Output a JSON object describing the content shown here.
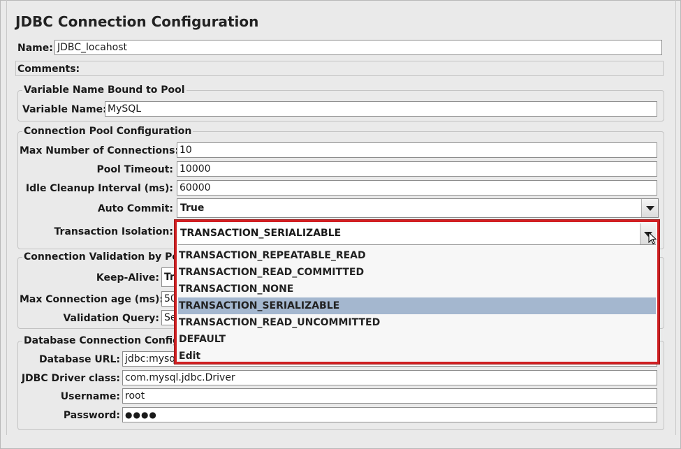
{
  "title": "JDBC Connection Configuration",
  "name": {
    "label": "Name:",
    "value": "JDBC_locahost"
  },
  "comments": {
    "label": "Comments:",
    "value": ""
  },
  "variable_group": {
    "legend": "Variable Name Bound to Pool",
    "variable_name": {
      "label": "Variable Name:",
      "value": "MySQL"
    }
  },
  "pool_group": {
    "legend": "Connection Pool Configuration",
    "max_connections": {
      "label": "Max Number of Connections:",
      "value": "10"
    },
    "pool_timeout": {
      "label": "Pool Timeout:",
      "value": "10000"
    },
    "idle_cleanup": {
      "label": "Idle Cleanup Interval (ms):",
      "value": "60000"
    },
    "auto_commit": {
      "label": "Auto Commit:",
      "value": "True"
    },
    "transaction_isolation": {
      "label": "Transaction Isolation:",
      "value": "TRANSACTION_SERIALIZABLE",
      "options": [
        "TRANSACTION_REPEATABLE_READ",
        "TRANSACTION_READ_COMMITTED",
        "TRANSACTION_NONE",
        "TRANSACTION_SERIALIZABLE",
        "TRANSACTION_READ_UNCOMMITTED",
        "DEFAULT",
        "Edit"
      ],
      "selected_index": 3
    }
  },
  "validation_group": {
    "legend": "Connection Validation by Poo",
    "keep_alive": {
      "label": "Keep-Alive:",
      "value": "Tr"
    },
    "max_age": {
      "label": "Max Connection age (ms):",
      "value": "50"
    },
    "validation_query": {
      "label": "Validation Query:",
      "value": "Se"
    }
  },
  "database_group": {
    "legend": "Database Connection Configu",
    "url": {
      "label": "Database URL:",
      "value": "jdbc:mysq"
    },
    "driver": {
      "label": "JDBC Driver class:",
      "value": "com.mysql.jdbc.Driver"
    },
    "username": {
      "label": "Username:",
      "value": "root"
    },
    "password": {
      "label": "Password:",
      "value": "●●●●"
    }
  },
  "colors": {
    "highlight_border": "#d01f22",
    "selected_item": "#a4b7cf",
    "panel_bg": "#eaeaea"
  }
}
